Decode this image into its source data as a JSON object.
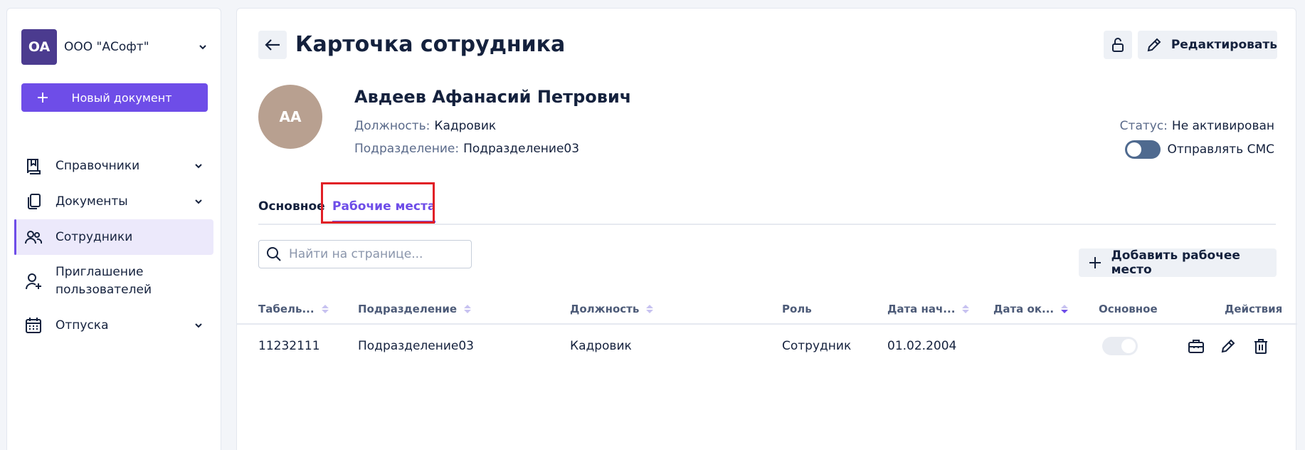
{
  "org": {
    "initials": "OA",
    "name": "ООО \"АСофт\""
  },
  "sidebar": {
    "new_document": "Новый документ",
    "items": [
      {
        "label": "Справочники",
        "icon": "book-icon"
      },
      {
        "label": "Документы",
        "icon": "documents-icon"
      },
      {
        "label": "Сотрудники",
        "icon": "users-icon"
      },
      {
        "label": "Приглашение пользователей",
        "icon": "user-plus-icon"
      },
      {
        "label": "Отпуска",
        "icon": "calendar-icon"
      }
    ]
  },
  "header": {
    "title": "Карточка сотрудника",
    "edit_label": "Редактировать"
  },
  "employee": {
    "initials": "АА",
    "name": "Авдеев Афанасий Петрович",
    "position_label": "Должность:",
    "position": "Кадровик",
    "department_label": "Подразделение:",
    "department": "Подразделение03",
    "status_label": "Статус:",
    "status": "Не активирован",
    "sms_label": "Отправлять СМС"
  },
  "tabs": {
    "main": "Основное",
    "workplaces": "Рабочие места"
  },
  "search": {
    "placeholder": "Найти на странице..."
  },
  "add_workplace": "Добавить рабочее место",
  "table": {
    "columns": {
      "tab_num": "Табель...",
      "department": "Подразделение",
      "position": "Должность",
      "role": "Роль",
      "start": "Дата нач...",
      "end": "Дата ок...",
      "primary": "Основное",
      "actions": "Действия"
    },
    "rows": [
      {
        "tab_num": "11232111",
        "department": "Подразделение03",
        "position": "Кадровик",
        "role": "Сотрудник",
        "start": "01.02.2004",
        "end": ""
      }
    ]
  },
  "colors": {
    "accent": "#6e4de8",
    "text": "#14213d",
    "highlight": "#e11f26"
  }
}
